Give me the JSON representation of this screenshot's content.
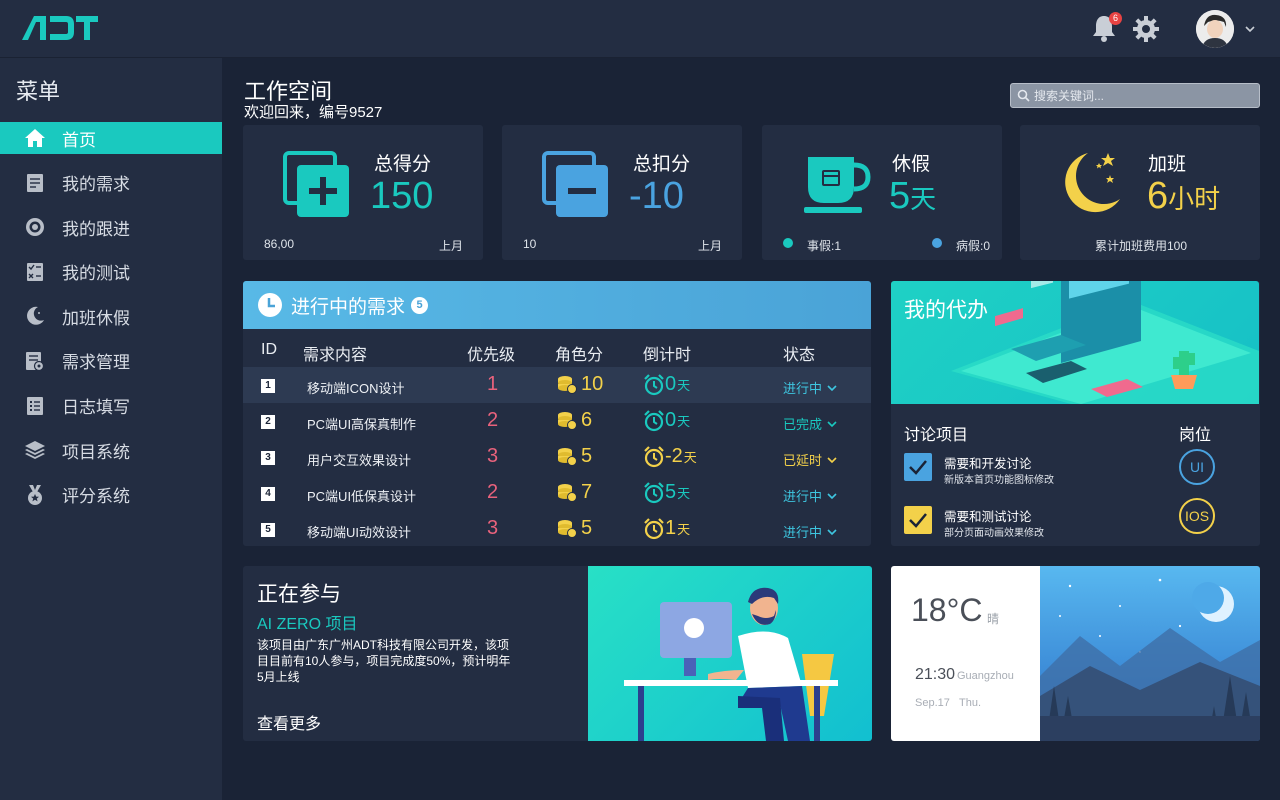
{
  "header": {
    "logo": "ADT",
    "notification_count": "6"
  },
  "sidebar": {
    "title": "菜单",
    "items": [
      {
        "label": "首页",
        "icon": "home-icon",
        "active": true
      },
      {
        "label": "我的需求",
        "icon": "document-icon"
      },
      {
        "label": "我的跟进",
        "icon": "target-icon"
      },
      {
        "label": "我的测试",
        "icon": "checklist-icon"
      },
      {
        "label": "加班休假",
        "icon": "moon-icon"
      },
      {
        "label": "需求管理",
        "icon": "doc-settings-icon"
      },
      {
        "label": "日志填写",
        "icon": "list-icon"
      },
      {
        "label": "项目系统",
        "icon": "layers-icon"
      },
      {
        "label": "评分系统",
        "icon": "medal-icon"
      }
    ]
  },
  "workspace": {
    "title": "工作空间",
    "subtitle": "欢迎回来，编号9527"
  },
  "search": {
    "placeholder": "搜索关键词..."
  },
  "stats": {
    "total_score": {
      "label": "总得分",
      "value": "150",
      "foot_left": "86,00",
      "foot_right": "上月"
    },
    "deduction": {
      "label": "总扣分",
      "value": "-10",
      "foot_left": "10",
      "foot_right": "上月"
    },
    "leave": {
      "label": "休假",
      "value": "5",
      "unit": "天",
      "personal": "事假:1",
      "sick": "病假:0"
    },
    "overtime": {
      "label": "加班",
      "value": "6",
      "unit": "小时",
      "foot": "累计加班费用100"
    }
  },
  "requirements": {
    "title": "进行中的需求",
    "count": "5",
    "columns": [
      "ID",
      "需求内容",
      "优先级",
      "角色分",
      "倒计时",
      "状态"
    ],
    "rows": [
      {
        "id": "1",
        "name": "移动端ICON设计",
        "priority": "1",
        "score": "10",
        "countdown": "0",
        "unit": "天",
        "status": "进行中",
        "status_color": "#3ec6e0",
        "clock_color": "#1ac9bf",
        "highlight": true
      },
      {
        "id": "2",
        "name": "PC端UI高保真制作",
        "priority": "2",
        "score": "6",
        "countdown": "0",
        "unit": "天",
        "status": "已完成",
        "status_color": "#1ac9bf",
        "clock_color": "#1ac9bf"
      },
      {
        "id": "3",
        "name": "用户交互效果设计",
        "priority": "3",
        "score": "5",
        "countdown": "-2",
        "unit": "天",
        "status": "已延时",
        "status_color": "#f3d14a",
        "clock_color": "#f3d14a"
      },
      {
        "id": "4",
        "name": "PC端UI低保真设计",
        "priority": "2",
        "score": "7",
        "countdown": "5",
        "unit": "天",
        "status": "进行中",
        "status_color": "#3ec6e0",
        "clock_color": "#1ac9bf"
      },
      {
        "id": "5",
        "name": "移动端UI动效设计",
        "priority": "3",
        "score": "5",
        "countdown": "1",
        "unit": "天",
        "status": "进行中",
        "status_color": "#3ec6e0",
        "clock_color": "#f3d14a"
      }
    ]
  },
  "todo": {
    "title": "我的代办",
    "discussion_label": "讨论项目",
    "position_label": "岗位",
    "tasks": [
      {
        "title": "需要和开发讨论",
        "sub": "新版本首页功能图标修改",
        "color": "#4aa3e0",
        "role": "UI",
        "role_color": "#4aa3e0"
      },
      {
        "title": "需要和测试讨论",
        "sub": "部分页面动画效果修改",
        "color": "#f3d14a",
        "role": "IOS",
        "role_color": "#f3d14a"
      }
    ]
  },
  "participating": {
    "title": "正在参与",
    "project": "AI ZERO 项目",
    "description": "该项目由广东广州ADT科技有限公司开发，该项目目前有10人参与，项目完成度50%，预计明年5月上线",
    "more": "查看更多"
  },
  "weather": {
    "temp": "18°C",
    "condition": "晴",
    "time": "21:30",
    "city": "Guangzhou",
    "date": "Sep.17",
    "day": "Thu."
  },
  "colors": {
    "accent": "#1ac9bf",
    "panel": "#232d42",
    "bg": "#1a2336",
    "yellow": "#f3d14a",
    "blue": "#4aa3e0",
    "red": "#e8627c"
  }
}
